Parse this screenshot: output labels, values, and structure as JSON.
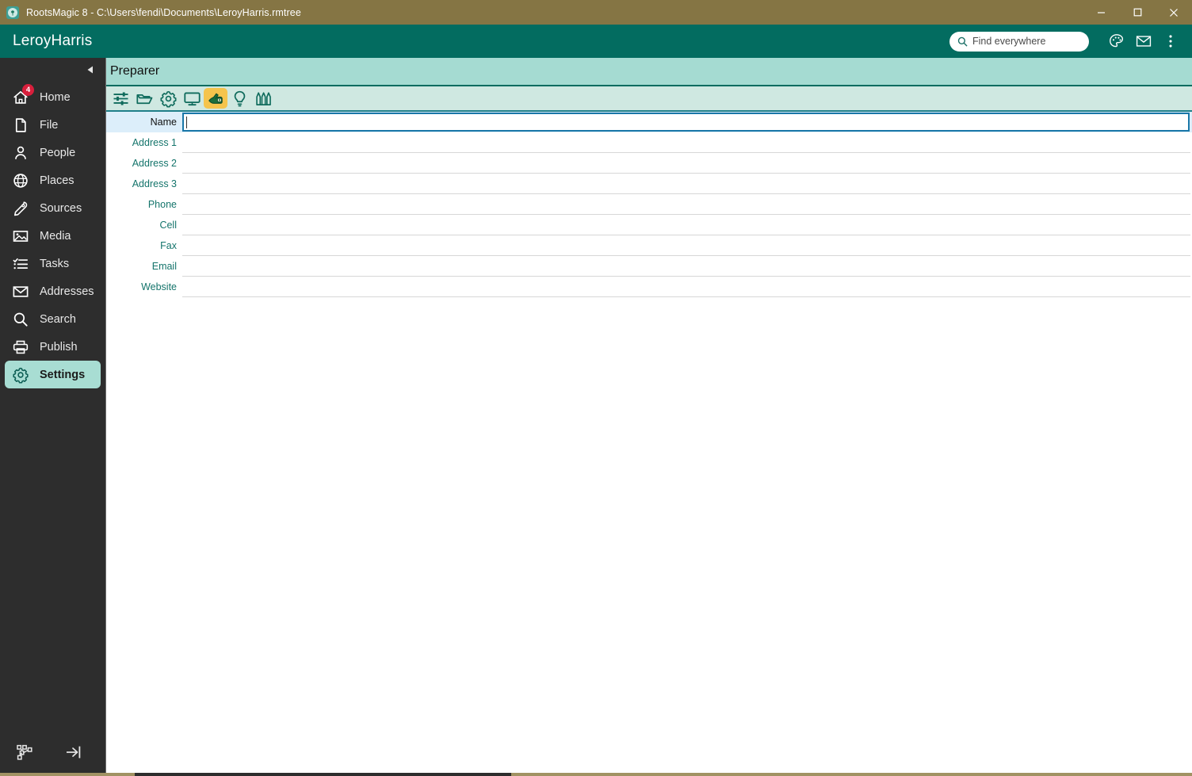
{
  "window": {
    "title": "RootsMagic 8 - C:\\Users\\fendi\\Documents\\LeroyHarris.rmtree",
    "app_icon": "tree-icon",
    "minimize_label": "Minimize",
    "maximize_label": "Maximize",
    "close_label": "Close"
  },
  "header": {
    "tree_name": "LeroyHarris",
    "search": {
      "placeholder": "Find everywhere",
      "value": "",
      "icon": "search-icon"
    },
    "buttons": [
      {
        "name": "palette-icon",
        "label": "Color coding"
      },
      {
        "name": "mail-icon",
        "label": "Messages"
      },
      {
        "name": "kebab-menu-icon",
        "label": "More options"
      }
    ]
  },
  "sidebar": {
    "collapse_label": "Collapse sidebar",
    "items": [
      {
        "label": "Home",
        "icon": "home-icon",
        "badge": "4",
        "active": false
      },
      {
        "label": "File",
        "icon": "file-icon",
        "badge": "",
        "active": false
      },
      {
        "label": "People",
        "icon": "people-icon",
        "badge": "",
        "active": false
      },
      {
        "label": "Places",
        "icon": "globe-icon",
        "badge": "",
        "active": false
      },
      {
        "label": "Sources",
        "icon": "pen-icon",
        "badge": "",
        "active": false
      },
      {
        "label": "Media",
        "icon": "image-icon",
        "badge": "",
        "active": false
      },
      {
        "label": "Tasks",
        "icon": "checklist-icon",
        "badge": "",
        "active": false
      },
      {
        "label": "Addresses",
        "icon": "envelope-icon",
        "badge": "",
        "active": false
      },
      {
        "label": "Search",
        "icon": "magnifier-icon",
        "badge": "",
        "active": false
      },
      {
        "label": "Publish",
        "icon": "printer-icon",
        "badge": "",
        "active": false
      },
      {
        "label": "Settings",
        "icon": "gear-icon",
        "badge": "",
        "active": true
      }
    ],
    "bottom_buttons": [
      {
        "name": "family-tree-icon",
        "label": "Tree view"
      },
      {
        "name": "collapse-panel-icon",
        "label": "Hide sidebar"
      }
    ]
  },
  "main": {
    "page_title": "Preparer",
    "toolbar": [
      {
        "name": "sliders-icon",
        "label": "Program options",
        "selected": false
      },
      {
        "name": "folder-icon",
        "label": "Folder options",
        "selected": false
      },
      {
        "name": "gear-icon",
        "label": "File options",
        "selected": false
      },
      {
        "name": "monitor-icon",
        "label": "Display options",
        "selected": false
      },
      {
        "name": "preparer-icon",
        "label": "Preparer",
        "selected": true
      },
      {
        "name": "lightbulb-icon",
        "label": "Hints",
        "selected": false
      },
      {
        "name": "books-icon",
        "label": "Sources",
        "selected": false
      }
    ],
    "fields": [
      {
        "label": "Name",
        "value": "",
        "focused": true
      },
      {
        "label": "Address 1",
        "value": "",
        "focused": false
      },
      {
        "label": "Address 2",
        "value": "",
        "focused": false
      },
      {
        "label": "Address 3",
        "value": "",
        "focused": false
      },
      {
        "label": "Phone",
        "value": "",
        "focused": false
      },
      {
        "label": "Cell",
        "value": "",
        "focused": false
      },
      {
        "label": "Fax",
        "value": "",
        "focused": false
      },
      {
        "label": "Email",
        "value": "",
        "focused": false
      },
      {
        "label": "Website",
        "value": "",
        "focused": false
      }
    ]
  },
  "colors": {
    "titlebar": "#857544",
    "header_teal": "#036c60",
    "page_header_mint": "#a5dbd2",
    "toolbar_mint": "#cfe8e1",
    "sidebar_dark": "#2d2d2d",
    "active_pill": "#a8ddd3",
    "badge_red": "#d81f3c",
    "selected_tool": "#f5c44c",
    "focus_row": "#dceefa",
    "label_teal": "#14746b"
  }
}
